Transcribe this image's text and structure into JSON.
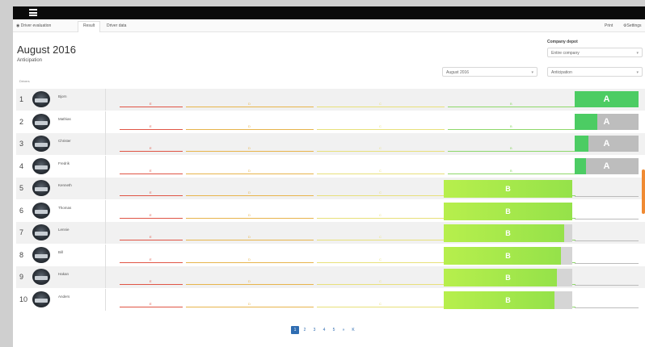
{
  "nav": {
    "menu_icon": "hamburger-icon",
    "breadcrumb": "Driver evaluation",
    "tab_result": "Result",
    "tab_driver_data": "Driver data",
    "right_print": "Print",
    "right_settings": "Settings"
  },
  "header": {
    "title": "August 2016",
    "subtitle": "Anticipation"
  },
  "filters": {
    "company_label": "Company depot",
    "company_value": "Entire company",
    "period_value": "August 2016",
    "category_value": "Anticipation"
  },
  "list_label": "Drivers",
  "grade_labels": [
    "E",
    "D",
    "C",
    "B"
  ],
  "drivers": [
    {
      "rank": "1",
      "name": "Bjorn",
      "grade": "A",
      "fill": 1.0
    },
    {
      "rank": "2",
      "name": "Mathias",
      "grade": "A",
      "fill": 0.35
    },
    {
      "rank": "3",
      "name": "Christer",
      "grade": "A",
      "fill": 0.22
    },
    {
      "rank": "4",
      "name": "Fredrik",
      "grade": "A",
      "fill": 0.18
    },
    {
      "rank": "5",
      "name": "Kenneth",
      "grade": "B",
      "fill": 1.0
    },
    {
      "rank": "6",
      "name": "Thomas",
      "grade": "B",
      "fill": 1.0
    },
    {
      "rank": "7",
      "name": "Lennie",
      "grade": "B",
      "fill": 0.94
    },
    {
      "rank": "8",
      "name": "Bill",
      "grade": "B",
      "fill": 0.91
    },
    {
      "rank": "9",
      "name": "Hakan",
      "grade": "B",
      "fill": 0.88
    },
    {
      "rank": "10",
      "name": "Anders",
      "grade": "B",
      "fill": 0.86
    }
  ],
  "pagination": {
    "pages": [
      "1",
      "2",
      "3",
      "4",
      "5"
    ],
    "next": "»",
    "last": "K",
    "current": "1"
  }
}
